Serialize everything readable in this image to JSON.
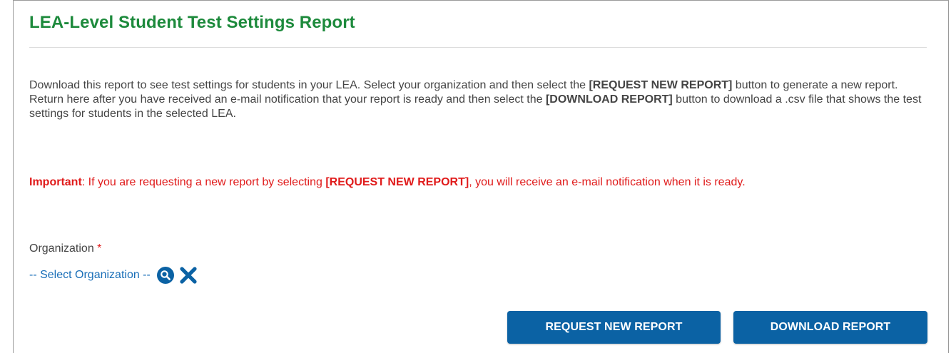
{
  "page": {
    "title": "LEA-Level Student Test Settings Report"
  },
  "intro": {
    "part1": "Download this report to see test settings for students in your LEA. Select your organization and then select the ",
    "request_bold": "[REQUEST NEW REPORT]",
    "part2": " button to generate a new report. Return here after you have received an e-mail notification that your report is ready and then select the ",
    "download_bold": "[DOWNLOAD REPORT]",
    "part3": " button to download a .csv file that shows the test settings for students in the selected LEA."
  },
  "important": {
    "label": "Important",
    "part1": ": If you are requesting a new report by selecting ",
    "request_bold": "[REQUEST NEW REPORT]",
    "part2": ", you will receive an e-mail notification when it is ready."
  },
  "organization": {
    "label": "Organization",
    "required_marker": "*",
    "select_text": "-- Select Organization --",
    "search_icon": "search-icon",
    "clear_icon": "close-icon"
  },
  "buttons": {
    "request_label": "REQUEST NEW REPORT",
    "download_label": "DOWNLOAD REPORT"
  },
  "colors": {
    "title": "#1d8a3c",
    "important": "#e01b1b",
    "link": "#1a6fb8",
    "button_bg": "#0b62a4",
    "button_text": "#ffffff"
  }
}
